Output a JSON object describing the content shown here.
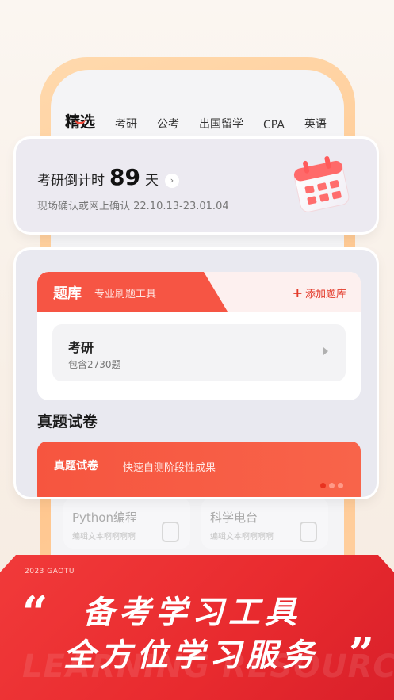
{
  "tabs": [
    "精选",
    "考研",
    "公考",
    "出国留学",
    "CPA",
    "英语"
  ],
  "countdown": {
    "label": "考研倒计时",
    "days": "89",
    "unit": "天",
    "subtitle": "现场确认或网上确认 22.10.13-23.01.04"
  },
  "bank": {
    "title": "题库",
    "subtitle": "专业刷题工具",
    "add_label": "添加题库",
    "item": {
      "title": "考研",
      "count": "包含2730题"
    }
  },
  "exam": {
    "section_title": "真题试卷",
    "banner_title": "真题试卷",
    "banner_sub": "快速自测阶段性成果"
  },
  "ghost_cards": [
    {
      "title": "Python编程",
      "sub": "编辑文本啊啊啊啊"
    },
    {
      "title": "科学电台",
      "sub": "编辑文本啊啊啊啊"
    }
  ],
  "promo": {
    "year": "2023 GAOTU",
    "line1": "备考学习工具",
    "line2": "全方位学习服务",
    "watermark": "LEARNING RESOURCES",
    "quote_open": "“",
    "quote_close": "”"
  },
  "colors": {
    "accent": "#f65544",
    "frame": "#ffc58c"
  }
}
